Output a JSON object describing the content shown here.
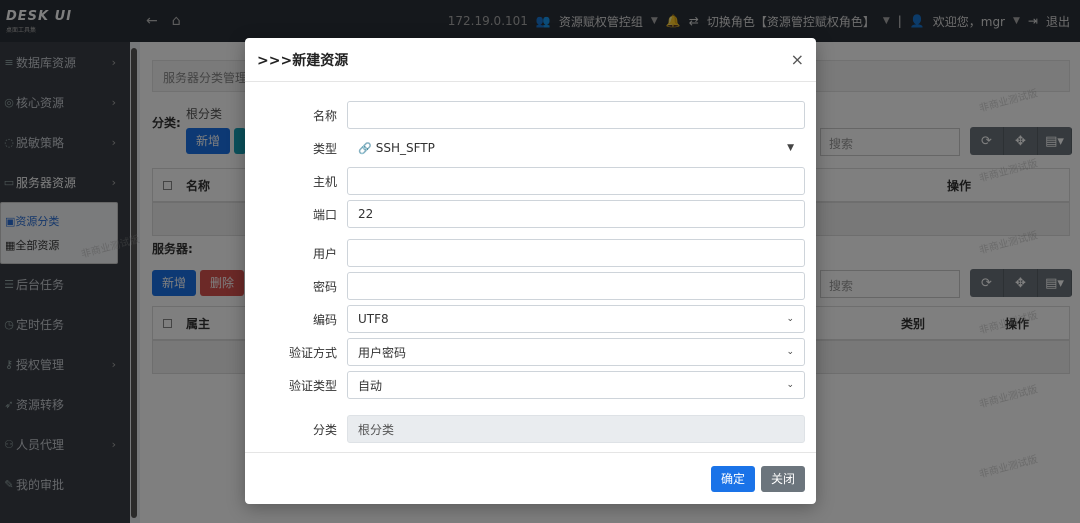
{
  "header": {
    "logo_main": "DESK UI",
    "logo_sub": "桌面工具集",
    "ip": "172.19.0.101",
    "group": "资源赋权管控组",
    "switch_role": "切换角色【资源管控赋权角色】",
    "welcome": "欢迎您，mgr",
    "logout": "退出"
  },
  "sidebar": {
    "items": [
      {
        "label": "数据库资源"
      },
      {
        "label": "核心资源"
      },
      {
        "label": "脱敏策略"
      },
      {
        "label": "服务器资源"
      },
      {
        "label": "后台任务"
      },
      {
        "label": "定时任务"
      },
      {
        "label": "授权管理"
      },
      {
        "label": "资源转移"
      },
      {
        "label": "人员代理"
      },
      {
        "label": "我的审批"
      }
    ],
    "sub_items": [
      {
        "label": "资源分类"
      },
      {
        "label": "全部资源"
      }
    ]
  },
  "main": {
    "breadcrumb": "服务器分类管理",
    "category_label": "分类:",
    "root_category": "根分类",
    "add_button": "新增",
    "search_placeholder": "搜索",
    "table1": {
      "name_col": "名称",
      "op_col": "操作"
    },
    "server_label": "服务器:",
    "add_button2": "新增",
    "delete_button": "删除",
    "search_placeholder2": "搜索",
    "table2": {
      "owner_col": "属主",
      "type_col": "类别",
      "op_col": "操作"
    }
  },
  "watermark": "非商业测试版",
  "modal": {
    "title": ">>>新建资源",
    "close": "×",
    "fields": {
      "name": {
        "label": "名称",
        "value": ""
      },
      "type": {
        "label": "类型",
        "value": "SSH_SFTP"
      },
      "host": {
        "label": "主机",
        "value": ""
      },
      "port": {
        "label": "端口",
        "value": "22"
      },
      "user": {
        "label": "用户",
        "value": ""
      },
      "password": {
        "label": "密码",
        "value": ""
      },
      "encoding": {
        "label": "编码",
        "value": "UTF8"
      },
      "auth_method": {
        "label": "验证方式",
        "value": "用户密码"
      },
      "auth_type": {
        "label": "验证类型",
        "value": "自动"
      },
      "category": {
        "label": "分类",
        "value": "根分类"
      }
    },
    "confirm": "确定",
    "close_button": "关闭"
  }
}
